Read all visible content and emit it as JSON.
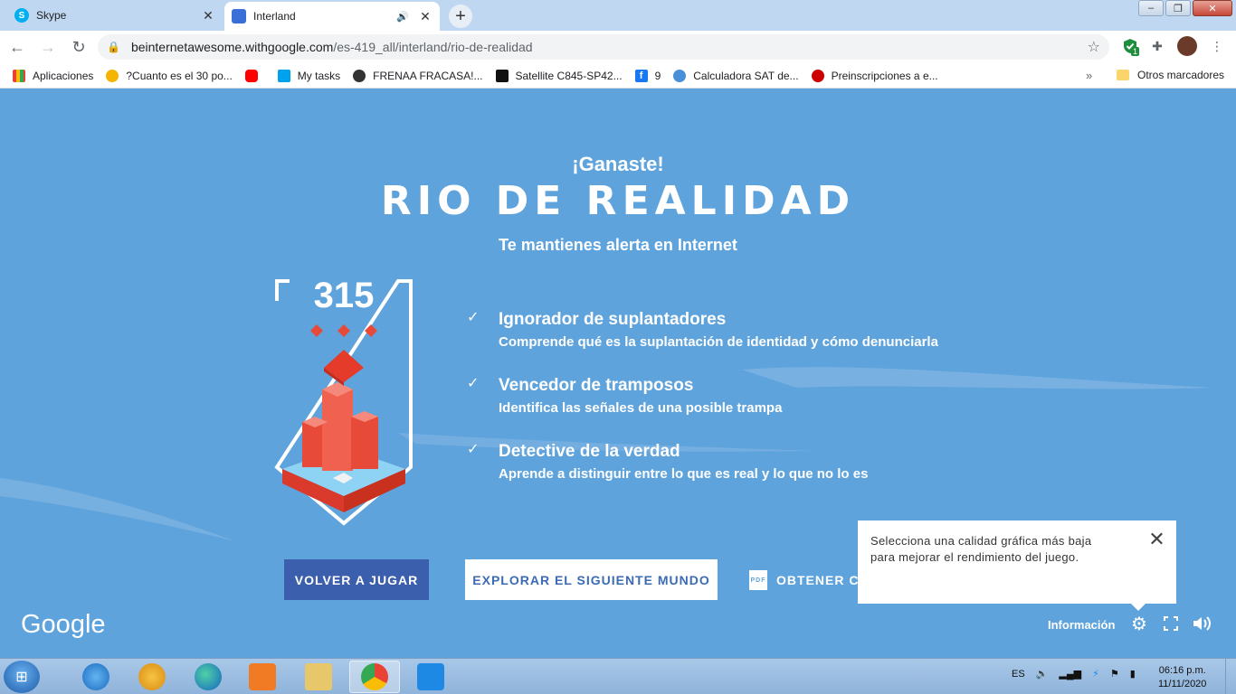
{
  "browser": {
    "tabs": [
      {
        "title": "Skype",
        "active": false
      },
      {
        "title": "Interland",
        "active": true
      }
    ],
    "url_host": "beinternetawesome.withgoogle.com",
    "url_path": "/es-419_all/interland/rio-de-realidad",
    "extension_badge": "1",
    "bookmarks": [
      {
        "label": "Aplicaciones",
        "color": "#4285f4"
      },
      {
        "label": "?Cuanto es el 30 po...",
        "color": "#f4b400"
      },
      {
        "label": "",
        "color": "#ff0000"
      },
      {
        "label": "My tasks",
        "color": "#00a2ed"
      },
      {
        "label": "FRENAA FRACASA!...",
        "color": "#333333"
      },
      {
        "label": "Satellite C845-SP42...",
        "color": "#111111"
      },
      {
        "label": "9",
        "color": "#1877f2"
      },
      {
        "label": "Calculadora SAT de...",
        "color": "#4a90d9"
      },
      {
        "label": "Preinscripciones a e...",
        "color": "#cc0000"
      }
    ],
    "bookmarks_more": "»",
    "other_bookmarks": "Otros marcadores"
  },
  "game": {
    "won": "¡Ganaste!",
    "world_title": "RIO DE REALIDAD",
    "subtitle": "Te mantienes alerta en Internet",
    "score": "315",
    "achievements": [
      {
        "title": "Ignorador de suplantadores",
        "desc": "Comprende qué es la suplantación de identidad y cómo denunciarla"
      },
      {
        "title": "Vencedor de tramposos",
        "desc": "Identifica las señales de una posible trampa"
      },
      {
        "title": "Detective de la verdad",
        "desc": "Aprende a distinguir entre lo que es real y lo que no lo es"
      }
    ],
    "buttons": {
      "replay": "VOLVER A JUGAR",
      "next_world": "EXPLORAR EL SIGUIENTE MUNDO",
      "certificate": "OBTENER CE",
      "pdf": "PDF"
    },
    "tooltip": "Selecciona una calidad gráfica más baja para mejorar el rendimiento del juego.",
    "google_logo": "Google",
    "info": "Información",
    "colors": {
      "background": "#5fa3dc",
      "replay_button": "#3b5fad",
      "next_text": "#3b6bb4",
      "crystal": "#e84a3a"
    }
  },
  "taskbar": {
    "language": "ES",
    "time": "06:16 p.m.",
    "date": "11/11/2020"
  }
}
